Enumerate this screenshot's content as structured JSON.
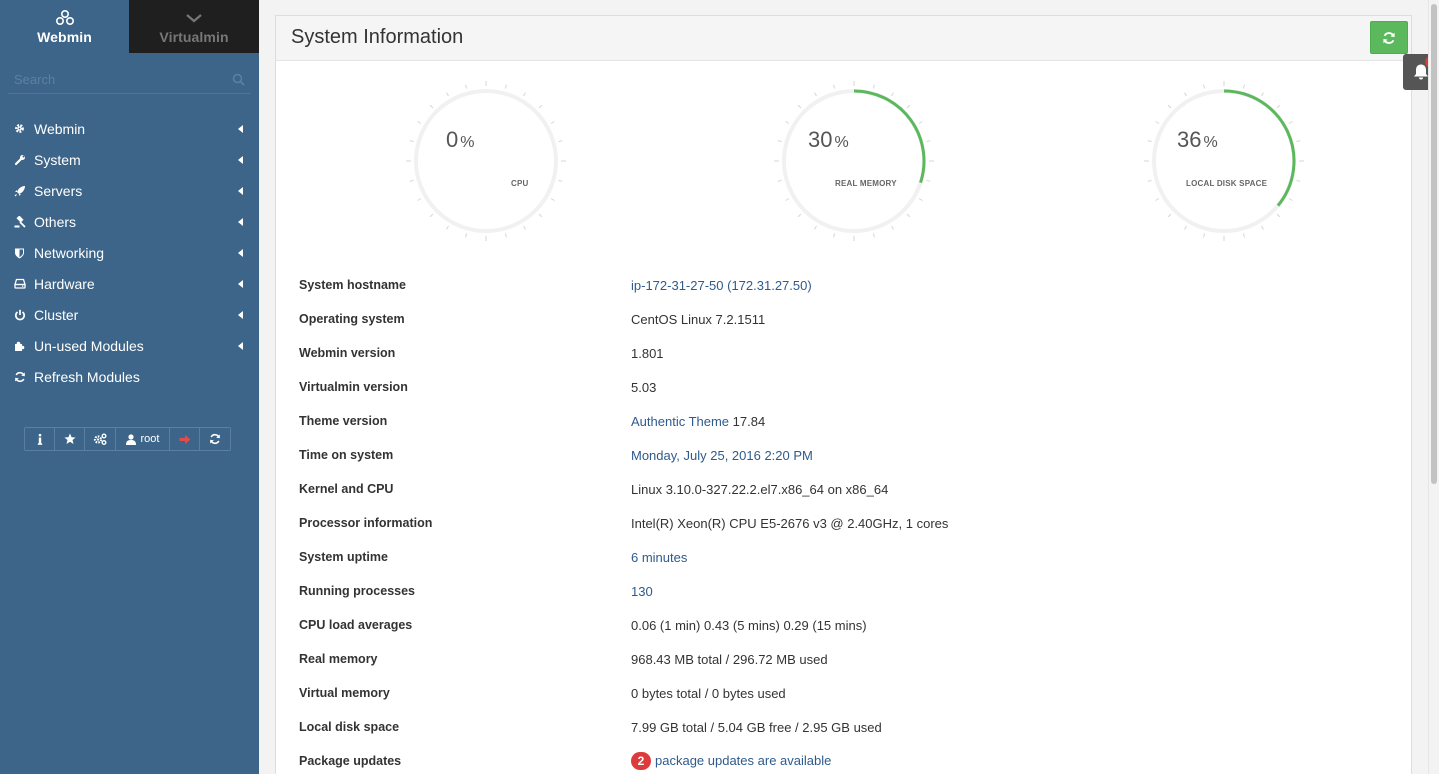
{
  "sidebar": {
    "tabs": [
      {
        "label": "Webmin",
        "icon": "webmin-logo-icon",
        "active": true
      },
      {
        "label": "Virtualmin",
        "icon": "chevron-down-icon",
        "active": false
      }
    ],
    "search_placeholder": "Search",
    "items": [
      {
        "label": "Webmin",
        "icon": "gear-icon"
      },
      {
        "label": "System",
        "icon": "wrench-icon"
      },
      {
        "label": "Servers",
        "icon": "rocket-icon"
      },
      {
        "label": "Others",
        "icon": "gavel-icon"
      },
      {
        "label": "Networking",
        "icon": "shield-icon"
      },
      {
        "label": "Hardware",
        "icon": "hdd-icon"
      },
      {
        "label": "Cluster",
        "icon": "power-icon"
      },
      {
        "label": "Un-used Modules",
        "icon": "puzzle-icon"
      },
      {
        "label": "Refresh Modules",
        "icon": "refresh-icon"
      }
    ],
    "toolbar": {
      "user_label": "root",
      "icons": [
        "info-icon",
        "star-icon",
        "cogs-icon",
        "user-icon",
        "logout-icon",
        "refresh-icon"
      ]
    }
  },
  "panel": {
    "title": "System Information",
    "gauges": [
      {
        "value": "0",
        "unit": "%",
        "caption": "CPU",
        "percent": 0
      },
      {
        "value": "30",
        "unit": "%",
        "caption": "REAL MEMORY",
        "percent": 30
      },
      {
        "value": "36",
        "unit": "%",
        "caption": "LOCAL DISK SPACE",
        "percent": 36
      }
    ],
    "info": {
      "hostname": {
        "label": "System hostname",
        "value": "ip-172-31-27-50 (172.31.27.50)"
      },
      "os": {
        "label": "Operating system",
        "value": "CentOS Linux 7.2.1511"
      },
      "webmin": {
        "label": "Webmin version",
        "value": "1.801"
      },
      "virtualmin": {
        "label": "Virtualmin version",
        "value": "5.03"
      },
      "theme": {
        "label": "Theme version",
        "link": "Authentic Theme",
        "value": "17.84"
      },
      "time": {
        "label": "Time on system",
        "value": "Monday, July 25, 2016 2:20 PM"
      },
      "kernel": {
        "label": "Kernel and CPU",
        "value": "Linux 3.10.0-327.22.2.el7.x86_64 on x86_64"
      },
      "processor": {
        "label": "Processor information",
        "value": "Intel(R) Xeon(R) CPU E5-2676 v3 @ 2.40GHz, 1 cores"
      },
      "uptime": {
        "label": "System uptime",
        "value": "6 minutes"
      },
      "processes": {
        "label": "Running processes",
        "value": "130"
      },
      "load": {
        "label": "CPU load averages",
        "value": "0.06 (1 min) 0.43 (5 mins) 0.29 (15 mins)"
      },
      "real_memory": {
        "label": "Real memory",
        "value": "968.43 MB total / 296.72 MB used"
      },
      "virtual_memory": {
        "label": "Virtual memory",
        "value": "0 bytes total / 0 bytes used"
      },
      "disk": {
        "label": "Local disk space",
        "value": "7.99 GB total / 5.04 GB free / 2.95 GB used"
      },
      "packages": {
        "label": "Package updates",
        "count": "2",
        "value": "package updates are available"
      }
    }
  },
  "notifications": {
    "count": "1",
    "icon": "bell-icon"
  },
  "colors": {
    "sidebar_bg": "#3d6589",
    "accent_green": "#5cb85c",
    "link": "#2e5b8c",
    "badge_red": "#dd3b3b"
  }
}
